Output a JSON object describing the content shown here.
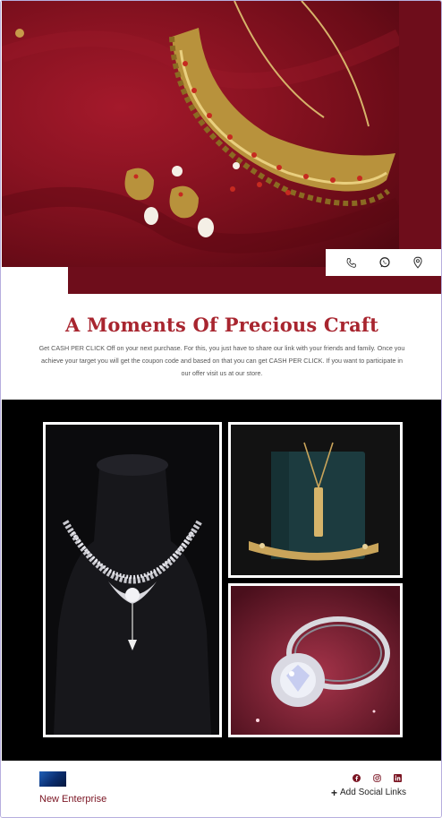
{
  "hero": {
    "image": "gold-bridal-necklace-earrings-on-red-velvet",
    "contact_icons": [
      "phone-icon",
      "whatsapp-icon",
      "location-pin-icon"
    ]
  },
  "intro": {
    "title": "A Moments Of Precious Craft",
    "body": "Get CASH PER CLICK Off on your next purchase. For this, you just have to share our link with your friends and family. Once you achieve your target you will get the coupon code and based on that you can get CASH PER CLICK. If you want to participate in our offer visit us at our store."
  },
  "gallery": {
    "images": [
      "diamond-necklace-on-bust",
      "gold-pendant-and-bracelet",
      "diamond-ring-on-red-fabric"
    ]
  },
  "footer": {
    "brand_name": "New Enterprise",
    "add_social_label": "Add Social Links",
    "social_icons": [
      "facebook-icon",
      "instagram-icon",
      "linkedin-icon"
    ]
  },
  "colors": {
    "accent": "#a8252f",
    "brand_text": "#7a1422",
    "hero_bg": "#6e0d1b",
    "gallery_bg": "#000000"
  }
}
